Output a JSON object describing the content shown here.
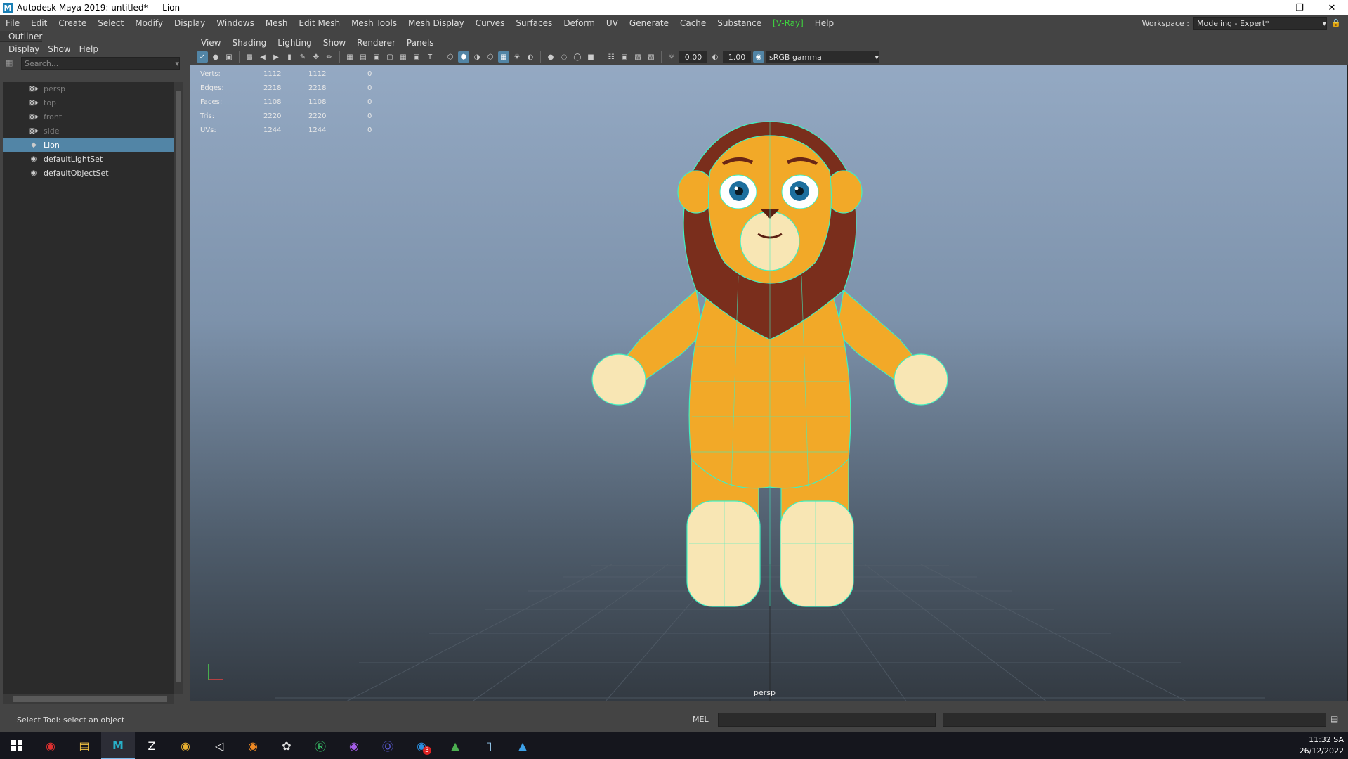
{
  "window": {
    "title": "Autodesk Maya 2019: untitled*   ---   Lion",
    "app_icon": "M"
  },
  "menubar": {
    "items": [
      "File",
      "Edit",
      "Create",
      "Select",
      "Modify",
      "Display",
      "Windows",
      "Mesh",
      "Edit Mesh",
      "Mesh Tools",
      "Mesh Display",
      "Curves",
      "Surfaces",
      "Deform",
      "UV",
      "Generate",
      "Cache",
      "Substance",
      "[V-Ray]",
      "Help"
    ],
    "vray_color": "#3fd23f"
  },
  "workspace": {
    "label": "Workspace :",
    "value": "Modeling - Expert*"
  },
  "outliner": {
    "tab": "Outliner",
    "menu": [
      "Display",
      "Show",
      "Help"
    ],
    "search_placeholder": "Search...",
    "items": [
      {
        "label": "persp",
        "icon": "camera-icon"
      },
      {
        "label": "top",
        "icon": "camera-icon"
      },
      {
        "label": "front",
        "icon": "camera-icon"
      },
      {
        "label": "side",
        "icon": "camera-icon"
      },
      {
        "label": "Lion",
        "icon": "mesh-icon"
      },
      {
        "label": "defaultLightSet",
        "icon": "set-icon"
      },
      {
        "label": "defaultObjectSet",
        "icon": "set-icon"
      }
    ],
    "selected_color": "#5285a6"
  },
  "viewport": {
    "menu": [
      "View",
      "Shading",
      "Lighting",
      "Show",
      "Renderer",
      "Panels"
    ],
    "exposure": "0.00",
    "gamma": "1.00",
    "color_space": "sRGB gamma",
    "camera": "persp",
    "hud": [
      {
        "label": "Verts:",
        "a": "1112",
        "b": "1112",
        "c": "0"
      },
      {
        "label": "Edges:",
        "a": "2218",
        "b": "2218",
        "c": "0"
      },
      {
        "label": "Faces:",
        "a": "1108",
        "b": "1108",
        "c": "0"
      },
      {
        "label": "Tris:",
        "a": "2220",
        "b": "2220",
        "c": "0"
      },
      {
        "label": "UVs:",
        "a": "1244",
        "b": "1244",
        "c": "0"
      }
    ],
    "wireframe_color": "#40f0c0"
  },
  "commandline": {
    "help_line": "Select Tool: select an object",
    "language": "MEL"
  },
  "taskbar": {
    "time": "11:32 SA",
    "date": "26/12/2022",
    "notification_count": "3"
  }
}
